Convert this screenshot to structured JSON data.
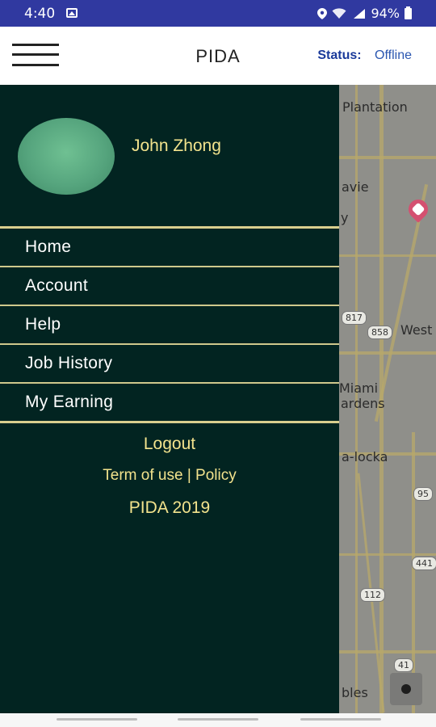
{
  "status_bar": {
    "time": "4:40",
    "battery": "94%",
    "icons": [
      "image-icon",
      "location-icon",
      "wifi-icon",
      "signal-icon",
      "battery-icon"
    ]
  },
  "app_bar": {
    "title": "PIDA",
    "status_label": "Status:",
    "status_value": "Offline",
    "menu_icon": "hamburger-icon"
  },
  "drawer": {
    "user_name": "John Zhong",
    "menu_items": [
      "Home",
      "Account",
      "Help",
      "Job History",
      "My Earning"
    ],
    "logout": "Logout",
    "terms": "Term of use",
    "separator": "|",
    "policy": "Policy",
    "copyright": "PIDA 2019"
  },
  "map": {
    "labels": [
      "Plantation",
      "avie",
      "y",
      "West",
      "Miami",
      "ardens",
      "a-locka",
      "bles"
    ],
    "route_shields": [
      "817",
      "858",
      "95",
      "441",
      "112",
      "41"
    ]
  },
  "colors": {
    "status_bar": "#3039a0",
    "drawer_bg": "#022421",
    "accent_text": "#f3e38d",
    "divider": "#d9cf8e",
    "status_label": "#1a3a9a"
  }
}
